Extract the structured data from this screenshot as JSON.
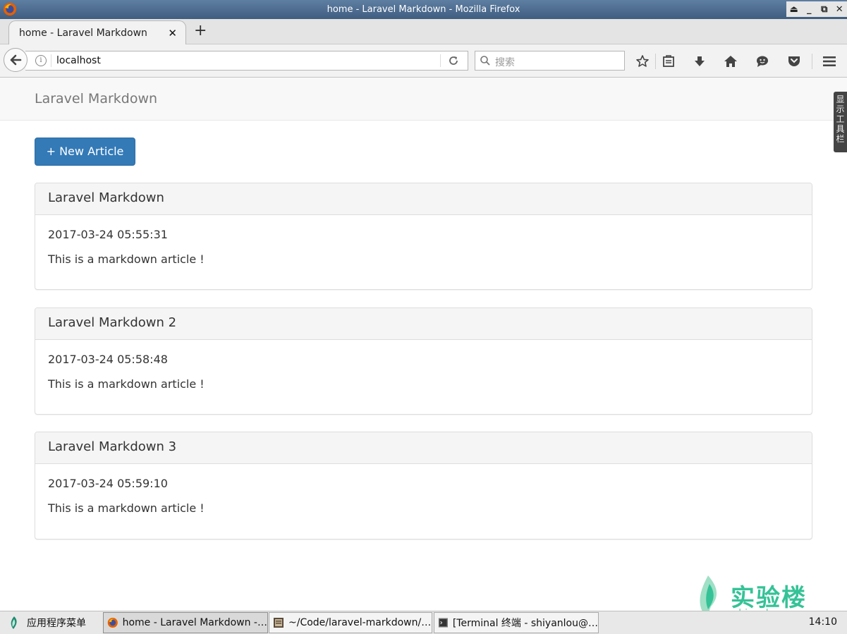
{
  "window": {
    "title": "home - Laravel Markdown - Mozilla Firefox",
    "controls": [
      "⏏",
      "_",
      "⧉",
      "✕"
    ]
  },
  "tabs": [
    {
      "label": "home - Laravel Markdown",
      "close": "✕"
    }
  ],
  "new_tab_label": "+",
  "navbar": {
    "url": "localhost",
    "search_placeholder": "搜索"
  },
  "page": {
    "brand": "Laravel Markdown",
    "new_article_label": "+ New Article",
    "show_toolbar_label": "显示工具栏",
    "articles": [
      {
        "title": "Laravel Markdown",
        "date": "2017-03-24 05:55:31",
        "body": "This is a markdown article !"
      },
      {
        "title": "Laravel Markdown 2",
        "date": "2017-03-24 05:58:48",
        "body": "This is a markdown article !"
      },
      {
        "title": "Laravel Markdown 3",
        "date": "2017-03-24 05:59:10",
        "body": "This is a markdown article !"
      }
    ]
  },
  "watermark": {
    "text": "实验楼",
    "sub": "shiyanlou.com"
  },
  "taskbar": {
    "start_label": "应用程序菜单",
    "tasks": [
      {
        "label": "home - Laravel Markdown -…"
      },
      {
        "label": "~/Code/laravel-markdown/…"
      },
      {
        "label": "[Terminal 终端 - shiyanlou@…"
      }
    ],
    "clock": "14:10"
  },
  "colors": {
    "primary_button": "#337ab7",
    "titlebar": "#4a6a8f",
    "watermark": "#35c296"
  }
}
